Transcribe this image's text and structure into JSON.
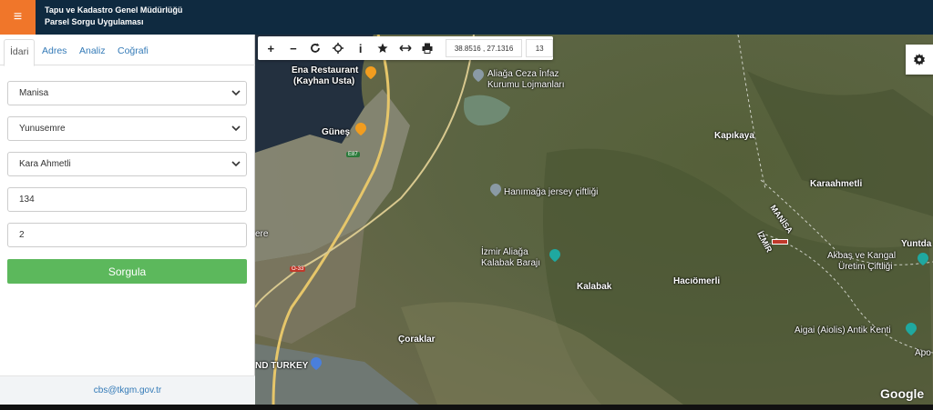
{
  "header": {
    "title_line1": "Tapu ve Kadastro Genel Müdürlüğü",
    "title_line2": "Parsel Sorgu Uygulaması",
    "menu_icon": "hamburger-icon",
    "accent": "#f0762a",
    "bg": "#0f2a40"
  },
  "sidebar": {
    "tabs": [
      {
        "label": "İdari",
        "active": true
      },
      {
        "label": "Adres",
        "active": false
      },
      {
        "label": "Analiz",
        "active": false
      },
      {
        "label": "Coğrafi",
        "active": false
      }
    ],
    "fields": {
      "il": "Manisa",
      "ilce": "Yunusemre",
      "mahalle": "Kara Ahmetli",
      "ada": "134",
      "parsel": "2"
    },
    "query_button": "Sorgula",
    "footer_email": "cbs@tkgm.gov.tr"
  },
  "map": {
    "toolbar": {
      "zoom_in": "+",
      "zoom_out": "−",
      "refresh_icon": "refresh-icon",
      "locate_icon": "crosshair-icon",
      "info": "i",
      "favorite_icon": "star-icon",
      "measure_icon": "measure-icon",
      "print_icon": "print-icon",
      "coordinates": "38.8516 , 27.1316",
      "zoom_level": "13"
    },
    "labels": {
      "ena": "Ena Restaurant",
      "ena2": "(Kayhan Usta)",
      "aliaga_ceza": "Aliağa Ceza İnfaz",
      "aliaga_ceza2": "Kurumu Lojmanları",
      "gunes": "Güneş",
      "kapikaya": "Kapıkaya",
      "karaahmetli": "Karaahmetli",
      "hanimaga": "Hanımağa jersey çiftliği",
      "izmir_aliaga": "İzmir Aliağa",
      "kalabak_baraji": "Kalabak Barajı",
      "kalabak": "Kalabak",
      "haciomerli": "Hacıömerli",
      "akbas": "Akbaş ve Kangal",
      "uretim": "Üretim Çiftliği",
      "yuntdag": "Yuntda",
      "aigai": "Aigai (Aiolis) Antik Kenti",
      "apo": "Apo",
      "coraklar": "Çoraklar",
      "turkey": "ND TURKEY",
      "manisa": "MANİSA",
      "izmir": "İZMİR",
      "road1": "E87",
      "road2": "O-33",
      "ere": "ere"
    },
    "google": "Google",
    "gear_icon": "gear-icon"
  }
}
